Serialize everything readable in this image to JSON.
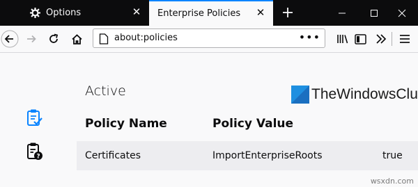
{
  "window": {
    "tabs": [
      {
        "label": "Options",
        "icon": "gear-icon",
        "active": false
      },
      {
        "label": "Enterprise Policies",
        "icon": "",
        "active": true
      }
    ],
    "colors": {
      "tabbar": "#0c0c0d",
      "accent": "#0a84ff",
      "page": "#f9f9fa",
      "row": "#ededf0",
      "sidebar_icon": "#0a84ff"
    }
  },
  "navbar": {
    "url": "about:policies"
  },
  "content": {
    "section_title": "Active",
    "columns": {
      "policy_name": "Policy Name",
      "policy_value": "Policy Value"
    },
    "rows": [
      {
        "name": "Certificates",
        "value": "ImportEnterpriseRoots",
        "extra": "true"
      }
    ]
  },
  "watermark": {
    "text": "TheWindowsClub"
  },
  "site_mark": "wsxdn.com"
}
